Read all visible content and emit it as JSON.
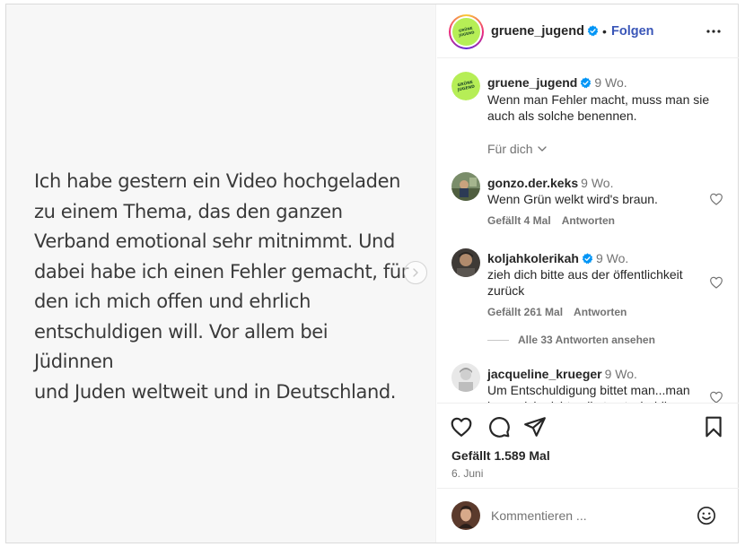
{
  "media": {
    "lines": [
      "Ich habe gestern ein Video hochgeladen",
      "zu einem Thema, das den ganzen",
      "Verband emotional sehr mitnimmt. Und",
      "dabei habe ich einen Fehler gemacht, für",
      "den ich mich offen und ehrlich",
      "entschuldigen will. Vor allem bei Jüdinnen",
      "und Juden weltweit und in Deutschland."
    ]
  },
  "header": {
    "username": "gruene_jugend",
    "separator": "•",
    "follow_label": "Folgen",
    "logo_text": "GRÜNE JUGEND"
  },
  "caption": {
    "username": "gruene_jugend",
    "time": "9 Wo.",
    "text": "Wenn man Fehler macht, muss man sie auch als solche benennen."
  },
  "filter_label": "Für dich",
  "comments": [
    {
      "username": "gonzo.der.keks",
      "time": "9 Wo.",
      "text": "Wenn Grün welkt wird's braun.",
      "likes": "Gefällt 4 Mal",
      "reply": "Antworten",
      "verified": false
    },
    {
      "username": "koljahkolerikah",
      "time": "9 Wo.",
      "text": "zieh dich bitte aus der öffentlichkeit zurück",
      "likes": "Gefällt 261 Mal",
      "reply": "Antworten",
      "verified": true
    },
    {
      "username": "jacqueline_krueger",
      "time": "9 Wo.",
      "text": "Um Entschuldigung bittet man...man kann sich nicht selbst entschuldigen",
      "verified": false
    }
  ],
  "view_replies": "Alle 33 Antworten ansehen",
  "post": {
    "likes": "Gefällt 1.589 Mal",
    "date": "6. Juni"
  },
  "comment_input": {
    "placeholder": "Kommentieren ..."
  },
  "colors": {
    "brand_green": "#b6ee56",
    "link_blue": "#3a56b8",
    "verified_blue": "#0095f6"
  },
  "icons": [
    "chevron-right-icon",
    "verified-icon",
    "more-options-icon",
    "chevron-down-icon",
    "heart-icon",
    "comment-icon",
    "share-icon",
    "bookmark-icon",
    "emoji-icon"
  ]
}
